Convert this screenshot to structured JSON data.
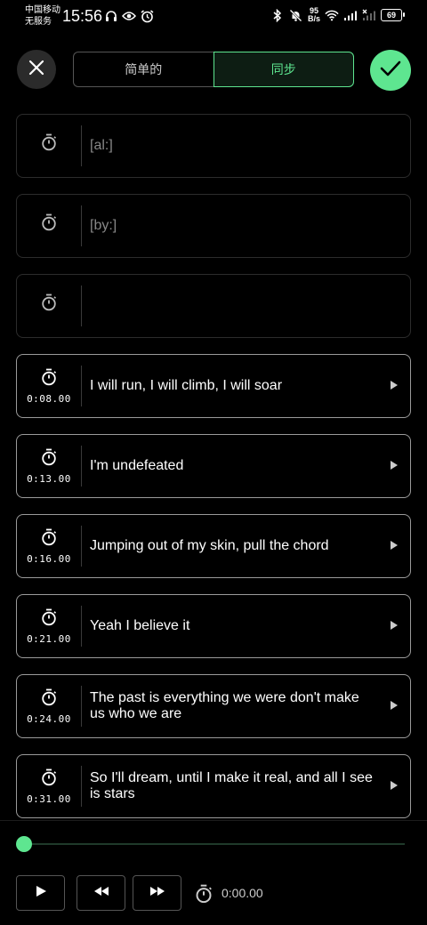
{
  "status_bar": {
    "carrier_line1": "中国移动",
    "carrier_line2": "无服务",
    "time": "15:56",
    "net_speed_value": "95",
    "net_speed_unit": "B/s",
    "battery": "69"
  },
  "toolbar": {
    "tab_plain": "简单的",
    "tab_synced": "同步"
  },
  "lyrics": [
    {
      "time": "",
      "text": "[al:]"
    },
    {
      "time": "",
      "text": "[by:]"
    },
    {
      "time": "",
      "text": ""
    },
    {
      "time": "0:08.00",
      "text": "I will run, I will climb, I will soar"
    },
    {
      "time": "0:13.00",
      "text": "I'm undefeated"
    },
    {
      "time": "0:16.00",
      "text": "Jumping out of my skin, pull the chord"
    },
    {
      "time": "0:21.00",
      "text": "Yeah I believe it"
    },
    {
      "time": "0:24.00",
      "text": "The past is everything we were don't make us who we are"
    },
    {
      "time": "0:31.00",
      "text": "So I'll dream, until I make it real, and all I see is stars"
    }
  ],
  "player": {
    "progress": 0,
    "position": "0:00.00"
  },
  "colors": {
    "accent": "#5ee690",
    "background": "#000000"
  }
}
